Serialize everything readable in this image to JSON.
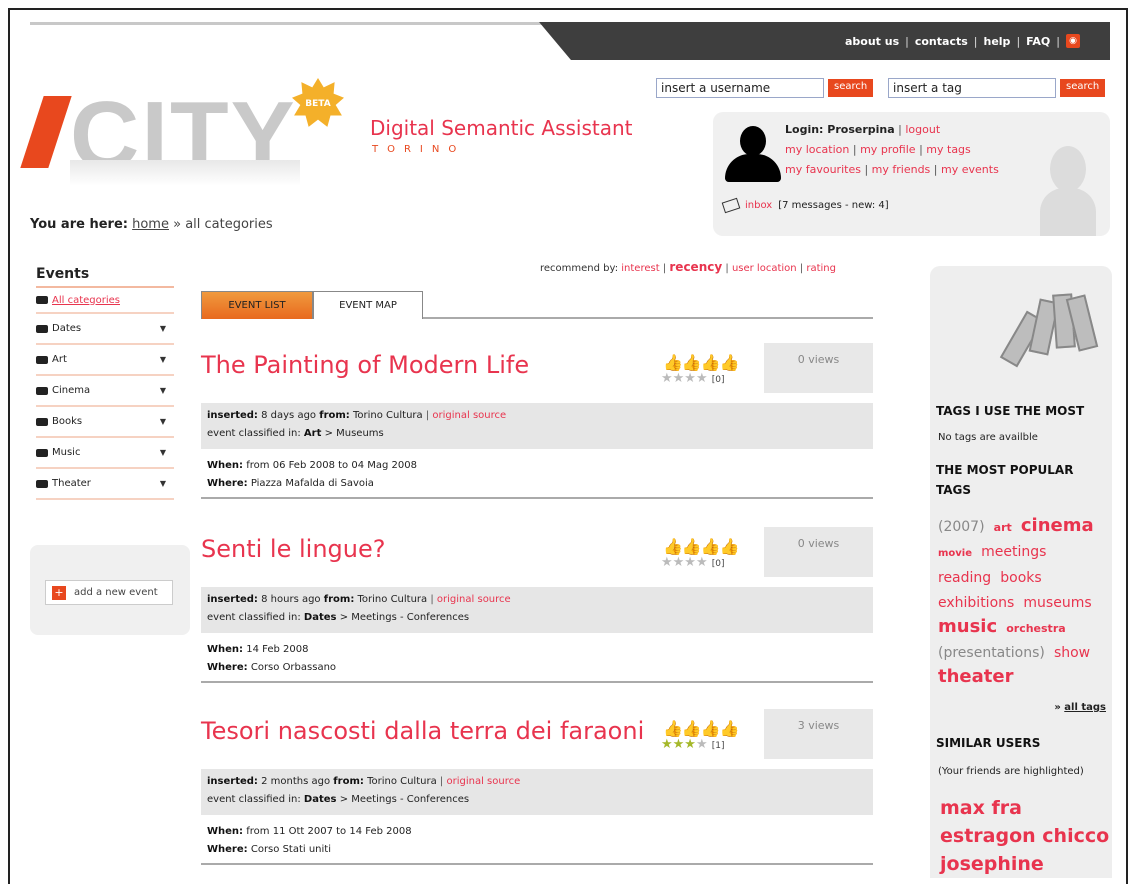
{
  "topnav": {
    "items": [
      "about us",
      "contacts",
      "help",
      "FAQ"
    ]
  },
  "logo": {
    "brand": "CITY",
    "badge": "BETA",
    "subtitle": "Digital Semantic Assistant",
    "city": "TORINO"
  },
  "search": {
    "user_placeholder": "insert a username",
    "user_button": "search",
    "tag_placeholder": "insert a tag",
    "tag_button": "search"
  },
  "user": {
    "login_label": "Login: Proserpina",
    "logout": "logout",
    "links": [
      "my location",
      "my profile",
      "my tags",
      "my favourites",
      "my friends",
      "my events"
    ],
    "inbox": "inbox",
    "inbox_status": "[7 messages - new: 4]"
  },
  "breadcrumb": {
    "label": "You are here:",
    "home": "home",
    "current": "» all categories"
  },
  "sidebar": {
    "title": "Events",
    "items": [
      {
        "label": "All categories"
      },
      {
        "label": "Dates"
      },
      {
        "label": "Art"
      },
      {
        "label": "Cinema"
      },
      {
        "label": "Books"
      },
      {
        "label": "Music"
      },
      {
        "label": "Theater"
      }
    ],
    "add_event": "add a new event"
  },
  "recommend": {
    "label": "recommend by:",
    "options": [
      "interest",
      "recency",
      "user location",
      "rating"
    ]
  },
  "tabs": [
    "EVENT LIST",
    "EVENT MAP"
  ],
  "events": [
    {
      "title": "The Painting of Modern Life",
      "views": "0 views",
      "rating_count": "[0]",
      "stars_on": 0,
      "inserted_label": "inserted:",
      "inserted": "8 days ago",
      "from_label": "from:",
      "from": "Torino Cultura",
      "source": "original source",
      "classified_label": "event classified in:",
      "cat": "Art",
      "subcat": "> Museums",
      "when_label": "When:",
      "when": "from 06 Feb 2008 to 04 Mag 2008",
      "where_label": "Where:",
      "where": "Piazza Mafalda di Savoia"
    },
    {
      "title": "Senti le lingue?",
      "views": "0 views",
      "rating_count": "[0]",
      "stars_on": 0,
      "inserted_label": "inserted:",
      "inserted": "8 hours ago",
      "from_label": "from:",
      "from": "Torino Cultura",
      "source": "original source",
      "classified_label": "event classified in:",
      "cat": "Dates",
      "subcat": "> Meetings - Conferences",
      "when_label": "When:",
      "when": "14 Feb 2008",
      "where_label": "Where:",
      "where": "Corso Orbassano"
    },
    {
      "title": "Tesori nascosti dalla terra dei faraoni",
      "views": "3 views",
      "rating_count": "[1]",
      "stars_on": 3,
      "inserted_label": "inserted:",
      "inserted": "2 months ago",
      "from_label": "from:",
      "from": "Torino Cultura",
      "source": "original source",
      "classified_label": "event classified in:",
      "cat": "Dates",
      "subcat": "> Meetings - Conferences",
      "when_label": "When:",
      "when": "from 11 Ott 2007 to 14 Feb 2008",
      "where_label": "Where:",
      "where": "Corso Stati uniti"
    }
  ],
  "right": {
    "tags_most": "TAGS I USE THE MOST",
    "no_tags": "No tags are availble",
    "popular": "THE MOST POPULAR TAGS",
    "cloud": [
      {
        "t": "(2007)",
        "c": "#888888"
      },
      {
        "t": "art",
        "c": "#e8344e"
      },
      {
        "t": "cinema",
        "c": "#e8344e"
      },
      {
        "t": "movie",
        "c": "#e8344e"
      },
      {
        "t": "meetings",
        "c": "#e8344e"
      },
      {
        "t": "reading",
        "c": "#e8344e"
      },
      {
        "t": "books",
        "c": "#e8344e"
      },
      {
        "t": "exhibitions",
        "c": "#e8344e"
      },
      {
        "t": "museums",
        "c": "#e8344e"
      },
      {
        "t": "music",
        "c": "#e8344e"
      },
      {
        "t": "orchestra",
        "c": "#e8344e"
      },
      {
        "t": "(presentations)",
        "c": "#888888"
      },
      {
        "t": "show",
        "c": "#e8344e"
      },
      {
        "t": "theater",
        "c": "#e8344e"
      }
    ],
    "all_tags": "all tags",
    "similar_title": "SIMILAR USERS",
    "similar_note": "(Your friends are highlighted)",
    "users": [
      "max",
      "fra",
      "estragon",
      "chicco",
      "josephine"
    ]
  },
  "colors": {
    "accent": "#e8344e",
    "orange": "#e8481e",
    "dark": "#3e3e3e"
  }
}
